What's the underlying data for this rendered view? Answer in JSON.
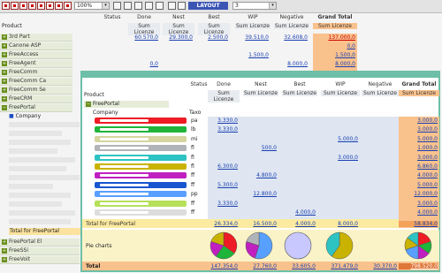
{
  "toolbar": {
    "zoom": "100%",
    "layout_label": "LAYOUT",
    "layout_select": "3"
  },
  "back": {
    "col_headers": [
      "Status",
      "Done",
      "Nest",
      "Best",
      "WIP",
      "Negative",
      "Grand Total"
    ],
    "sum_label": "Sum Licenze",
    "product_label": "Product",
    "rows": [
      {
        "label": "3rd Part",
        "done": "60.570,0",
        "nest": "29.300,0",
        "best": "2.500,0",
        "wip": "39.510,0",
        "neg": "32.608,0",
        "gt": "137.000,0"
      },
      {
        "label": "Canone ASP",
        "done": "",
        "nest": "",
        "best": "",
        "wip": "",
        "neg": "",
        "gt": "0,0"
      },
      {
        "label": "FreeAccess",
        "done": "",
        "nest": "",
        "best": "",
        "wip": "1.500,0",
        "neg": "",
        "gt": "1.500,0"
      },
      {
        "label": "FreeAgent",
        "done": "0,0",
        "nest": "",
        "best": "",
        "wip": "",
        "neg": "8.000,0",
        "gt": "8.000,0"
      },
      {
        "label": "FreeComm",
        "done": "",
        "nest": "",
        "best": "",
        "wip": "",
        "neg": "",
        "gt": ""
      },
      {
        "label": "FreeComm Ca",
        "done": "",
        "nest": "",
        "best": "",
        "wip": "",
        "neg": "",
        "gt": ""
      },
      {
        "label": "FreeComm Se",
        "done": "",
        "nest": "",
        "best": "",
        "wip": "",
        "neg": "",
        "gt": ""
      },
      {
        "label": "FreeCRM",
        "done": "",
        "nest": "",
        "best": "",
        "wip": "",
        "neg": "",
        "gt": ""
      },
      {
        "label": "FreePortal",
        "done": "",
        "nest": "",
        "best": "",
        "wip": "",
        "neg": "",
        "gt": ""
      }
    ],
    "company_label": "Company",
    "total_freeportal": "Total for FreePortal",
    "tail_rows": [
      "FreePortal El",
      "FreeSSi",
      "FreeVoit"
    ]
  },
  "front": {
    "col_headers": [
      "Status",
      "Done",
      "Nest",
      "Best",
      "WIP",
      "Negative",
      "Grand Total"
    ],
    "sum_label": "Sum Licenze",
    "product_label": "Product",
    "group_label": "FreePortal",
    "company_label": "Company",
    "taxo_label": "Taxo",
    "rows": [
      {
        "code": "pa",
        "color": "#ee1c24",
        "done": "3.330,0",
        "nest": "",
        "best": "",
        "wip": "",
        "neg": "",
        "gt": "3.000,0"
      },
      {
        "code": "lb",
        "color": "#1fb43a",
        "done": "3.330,0",
        "nest": "",
        "best": "",
        "wip": "",
        "neg": "",
        "gt": "3.000,0"
      },
      {
        "code": "mi",
        "color": "#d5d5a0",
        "done": "",
        "nest": "",
        "best": "",
        "wip": "5.000,0",
        "neg": "",
        "gt": "5.000,0"
      },
      {
        "code": "fl",
        "color": "#b0b4b8",
        "done": "",
        "nest": "500,0",
        "best": "",
        "wip": "",
        "neg": "",
        "gt": "1.000,0"
      },
      {
        "code": "fl",
        "color": "#2ec3c3",
        "done": "",
        "nest": "",
        "best": "",
        "wip": "3.000,0",
        "neg": "",
        "gt": "3.000,0"
      },
      {
        "code": "fl",
        "color": "#c9b300",
        "done": "6.300,0",
        "nest": "",
        "best": "",
        "wip": "",
        "neg": "",
        "gt": "6.860,0"
      },
      {
        "code": "ff",
        "color": "#c020c0",
        "done": "",
        "nest": "4.800,0",
        "best": "",
        "wip": "",
        "neg": "",
        "gt": "4.000,0"
      },
      {
        "code": "ff",
        "color": "#1a55d0",
        "done": "5.300,0",
        "nest": "",
        "best": "",
        "wip": "",
        "neg": "",
        "gt": "5.000,0"
      },
      {
        "code": "pp",
        "color": "#58a0ff",
        "done": "",
        "nest": "12.800,0",
        "best": "",
        "wip": "",
        "neg": "",
        "gt": "12.000,0"
      },
      {
        "code": "ff",
        "color": "#b6e05a",
        "done": "3.330,0",
        "nest": "",
        "best": "",
        "wip": "",
        "neg": "",
        "gt": "3.000,0"
      },
      {
        "code": "ff",
        "color": "#dddddd",
        "done": "",
        "nest": "",
        "best": "4.000,0",
        "wip": "",
        "neg": "",
        "gt": "4.000,0"
      }
    ],
    "total_label": "Total for FreePortal",
    "total": {
      "done": "26.334,0",
      "nest": "16.500,0",
      "best": "4.000,0",
      "wip": "8.000,0",
      "neg": "",
      "gt": "58.834,0"
    },
    "pie_label": "Pie charts",
    "grand_label": "Total",
    "grand": {
      "done": "147.354,0",
      "nest": "27.760,0",
      "best": "33.605,0",
      "wip": "371.479,0",
      "neg": "30.370,0",
      "gt": "798.520,0"
    }
  },
  "pies": [
    {
      "name": "done",
      "slices": [
        {
          "v": 0.35,
          "c": "#ee1c24"
        },
        {
          "v": 0.25,
          "c": "#1fb43a"
        },
        {
          "v": 0.2,
          "c": "#c020c0"
        },
        {
          "v": 0.2,
          "c": "#c9b300"
        }
      ]
    },
    {
      "name": "nest",
      "slices": [
        {
          "v": 0.55,
          "c": "#58a0ff"
        },
        {
          "v": 0.25,
          "c": "#c020c0"
        },
        {
          "v": 0.2,
          "c": "#b0b4b8"
        }
      ]
    },
    {
      "name": "best",
      "slices": [
        {
          "v": 1.0,
          "c": "#c8c8ff"
        }
      ]
    },
    {
      "name": "wip",
      "slices": [
        {
          "v": 0.6,
          "c": "#c9b300"
        },
        {
          "v": 0.4,
          "c": "#2ec3c3"
        }
      ]
    },
    {
      "name": "gt",
      "slices": [
        {
          "v": 0.2,
          "c": "#ee1c24"
        },
        {
          "v": 0.15,
          "c": "#1fb43a"
        },
        {
          "v": 0.15,
          "c": "#c020c0"
        },
        {
          "v": 0.2,
          "c": "#58a0ff"
        },
        {
          "v": 0.15,
          "c": "#c9b300"
        },
        {
          "v": 0.15,
          "c": "#2ec3c3"
        }
      ]
    }
  ]
}
